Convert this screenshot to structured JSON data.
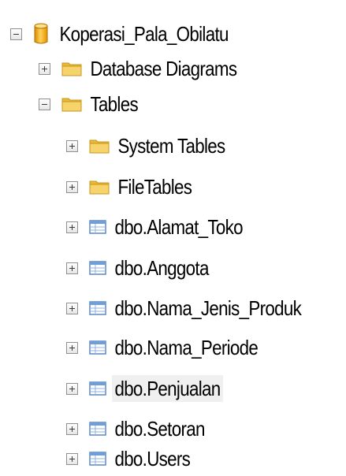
{
  "tree": {
    "root": {
      "label": "Koperasi_Pala_Obilatu",
      "icon": "database-icon",
      "state": "expanded"
    },
    "database_diagrams": {
      "label": "Database Diagrams",
      "icon": "folder-icon",
      "state": "collapsed"
    },
    "tables": {
      "label": "Tables",
      "icon": "folder-icon",
      "state": "expanded"
    },
    "system_tables": {
      "label": "System Tables",
      "icon": "folder-icon",
      "state": "collapsed"
    },
    "file_tables": {
      "label": "FileTables",
      "icon": "folder-icon",
      "state": "collapsed"
    },
    "table_items": [
      {
        "label": "dbo.Alamat_Toko",
        "icon": "table-icon",
        "state": "collapsed"
      },
      {
        "label": "dbo.Anggota",
        "icon": "table-icon",
        "state": "collapsed"
      },
      {
        "label": "dbo.Nama_Jenis_Produk",
        "icon": "table-icon",
        "state": "collapsed"
      },
      {
        "label": "dbo.Nama_Periode",
        "icon": "table-icon",
        "state": "collapsed"
      },
      {
        "label": "dbo.Penjualan",
        "icon": "table-icon",
        "state": "collapsed",
        "selected": true
      },
      {
        "label": "dbo.Setoran",
        "icon": "table-icon",
        "state": "collapsed"
      },
      {
        "label": "dbo.Users",
        "icon": "table-icon",
        "state": "collapsed"
      }
    ]
  },
  "colors": {
    "folder": "#f2c84b",
    "database": "#f5b31b",
    "table": "#6f9fd8",
    "selection": "#f0f0f0"
  }
}
